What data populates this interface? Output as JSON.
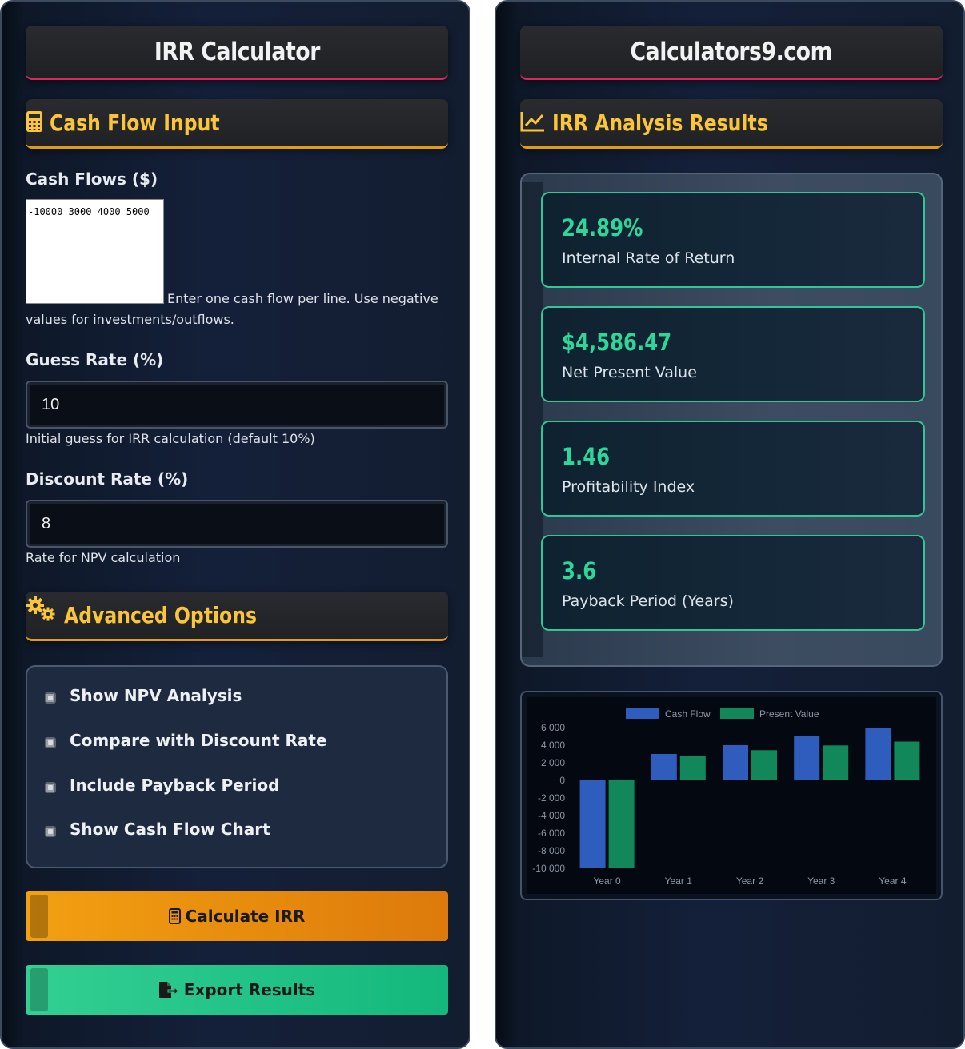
{
  "left": {
    "title": "IRR Calculator",
    "section_input": "Cash Flow Input",
    "cash_flows_label": "Cash Flows ($)",
    "cash_flows_value": "-10000 3000 4000 5000",
    "cash_flows_hint": "Enter one cash flow per line. Use negative values for investments/outflows.",
    "guess_label": "Guess Rate (%)",
    "guess_value": "10",
    "guess_hint": "Initial guess for IRR calculation (default 10%)",
    "discount_label": "Discount Rate (%)",
    "discount_value": "8",
    "discount_hint": "Rate for NPV calculation",
    "section_advanced": "Advanced Options",
    "options": [
      "Show NPV Analysis",
      "Compare with Discount Rate",
      "Include Payback Period",
      "Show Cash Flow Chart"
    ],
    "calculate_label": "Calculate IRR",
    "export_label": "Export Results"
  },
  "right": {
    "title": "Calculators9.com",
    "section_results": "IRR Analysis Results",
    "results": [
      {
        "value": "24.89%",
        "label": "Internal Rate of Return"
      },
      {
        "value": "$4,586.47",
        "label": "Net Present Value"
      },
      {
        "value": "1.46",
        "label": "Profitability Index"
      },
      {
        "value": "3.6",
        "label": "Payback Period (Years)"
      }
    ]
  },
  "colors": {
    "accent_yellow": "#fbc53a",
    "accent_green": "#2ed69a",
    "cash_flow_bar": "#2f5dbd",
    "present_value_bar": "#11875a"
  },
  "chart_data": {
    "type": "bar",
    "categories": [
      "Year 0",
      "Year 1",
      "Year 2",
      "Year 3",
      "Year 4"
    ],
    "series": [
      {
        "name": "Cash Flow",
        "values": [
          -10000,
          3000,
          4000,
          5000,
          6000
        ]
      },
      {
        "name": "Present Value",
        "values": [
          -10000,
          2778,
          3429,
          3969,
          4410
        ]
      }
    ],
    "yticks": [
      "6 000",
      "4 000",
      "2 000",
      "0",
      "-2 000",
      "-4 000",
      "-6 000",
      "-8 000",
      "-10 000"
    ],
    "ylim": [
      -10000,
      6000
    ],
    "legend": "top",
    "grid": false
  }
}
